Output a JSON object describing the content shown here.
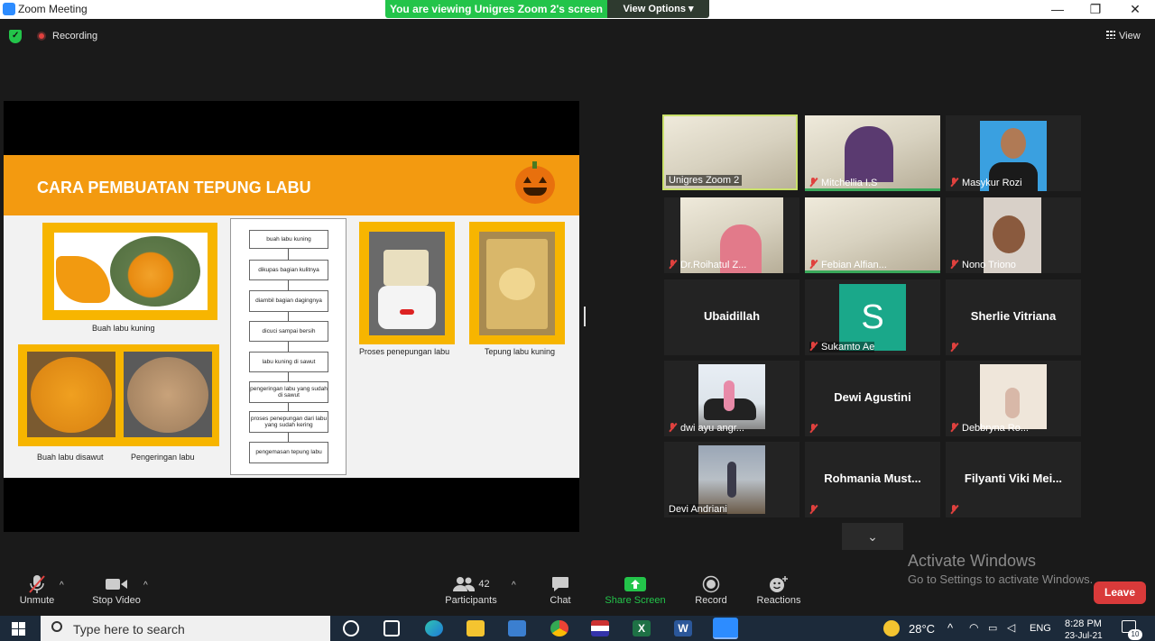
{
  "window": {
    "title": "Zoom Meeting",
    "minimize": "—",
    "restore": "❐",
    "close": "✕"
  },
  "banner": {
    "viewing": "You are viewing Unigres Zoom 2's screen",
    "view_options": "View Options ▾"
  },
  "status": {
    "recording": "Recording",
    "view": "View"
  },
  "slide": {
    "title": "CARA PEMBUATAN TEPUNG LABU",
    "captions": {
      "buah_labu_kuning": "Buah labu kuning",
      "buah_labu_disawut": "Buah labu disawut",
      "pengeringan_labu": "Pengeringan labu",
      "proses_penepungan": "Proses penepungan labu",
      "tepung_labu_kuning": "Tepung labu kuning"
    },
    "flow_steps": [
      "buah labu kuning",
      "dikupas bagian kulitnya",
      "diambil bagian dagingnya",
      "dicuci sampai bersih",
      "labu kuning di sawut",
      "pengeringan labu yang sudah di sawut",
      "proses penepungan dari labu yang sudah kering",
      "pengemasan tepung labu"
    ]
  },
  "participants": [
    {
      "name": "Unigres Zoom 2",
      "muted": false
    },
    {
      "name": "Mitchellia I.S",
      "muted": true
    },
    {
      "name": "Masykur Rozi",
      "muted": true
    },
    {
      "name": "Dr.Roihatul Z...",
      "muted": true
    },
    {
      "name": "Febian Alfian...",
      "muted": true
    },
    {
      "name": "Nono Triono",
      "muted": true
    },
    {
      "name": "Ubaidillah",
      "muted": false
    },
    {
      "name": "Sukamto Ae",
      "muted": true,
      "avatar_letter": "S"
    },
    {
      "name": "Sherlie Vitriana",
      "muted": true
    },
    {
      "name": "dwi ayu angr...",
      "muted": true
    },
    {
      "name": "Dewi Agustini",
      "muted": true
    },
    {
      "name": "Debbryna Ro...",
      "muted": true
    },
    {
      "name": "Devi Andriani",
      "muted": false
    },
    {
      "name": "Rohmania Must...",
      "muted": true
    },
    {
      "name": "Filyanti Viki Mei...",
      "muted": true
    }
  ],
  "watermark": {
    "line1": "Activate Windows",
    "line2": "Go to Settings to activate Windows."
  },
  "toolbar": {
    "unmute": "Unmute",
    "stop_video": "Stop Video",
    "participants": "Participants",
    "participants_count": "42",
    "chat": "Chat",
    "share_screen": "Share Screen",
    "record": "Record",
    "reactions": "Reactions",
    "leave": "Leave"
  },
  "taskbar": {
    "search_placeholder": "Type here to search",
    "temperature": "28°C",
    "language": "ENG",
    "time": "8:28 PM",
    "date": "23-Jul-21",
    "notifications": "10"
  },
  "colors": {
    "zoom_blue": "#2d8cff",
    "banner_green": "#23c44a",
    "leave_red": "#d93a3a",
    "slide_orange": "#f39a10"
  }
}
